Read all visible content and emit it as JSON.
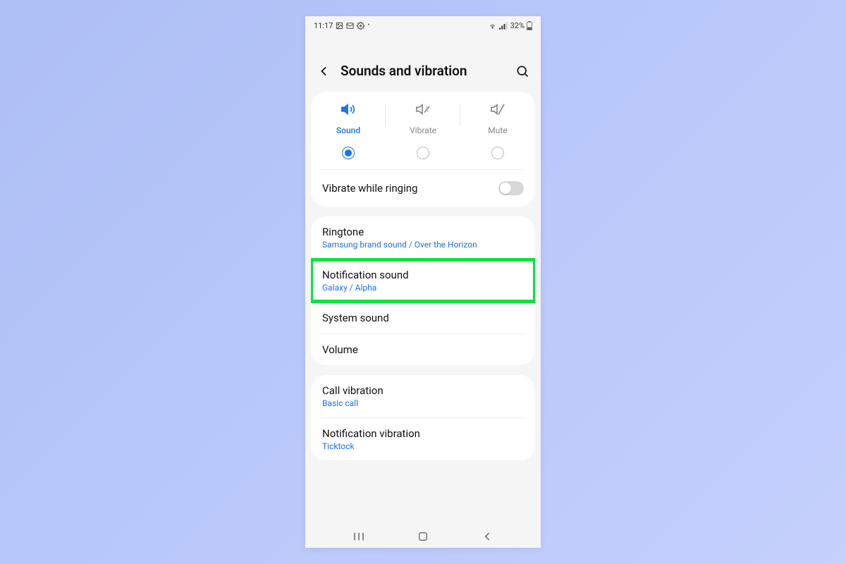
{
  "status": {
    "time": "11:17",
    "battery": "32%"
  },
  "header": {
    "title": "Sounds and vibration"
  },
  "modes": {
    "sound": "Sound",
    "vibrate": "Vibrate",
    "mute": "Mute",
    "selected": "sound"
  },
  "vibrate_while_ringing": {
    "label": "Vibrate while ringing",
    "enabled": false
  },
  "ringtone": {
    "title": "Ringtone",
    "sub": "Samsung brand sound / Over the Horizon"
  },
  "notification_sound": {
    "title": "Notification sound",
    "sub": "Galaxy / Alpha"
  },
  "system_sound": {
    "title": "System sound"
  },
  "volume": {
    "title": "Volume"
  },
  "call_vibration": {
    "title": "Call vibration",
    "sub": "Basic call"
  },
  "notification_vibration": {
    "title": "Notification vibration",
    "sub": "Ticktock"
  }
}
